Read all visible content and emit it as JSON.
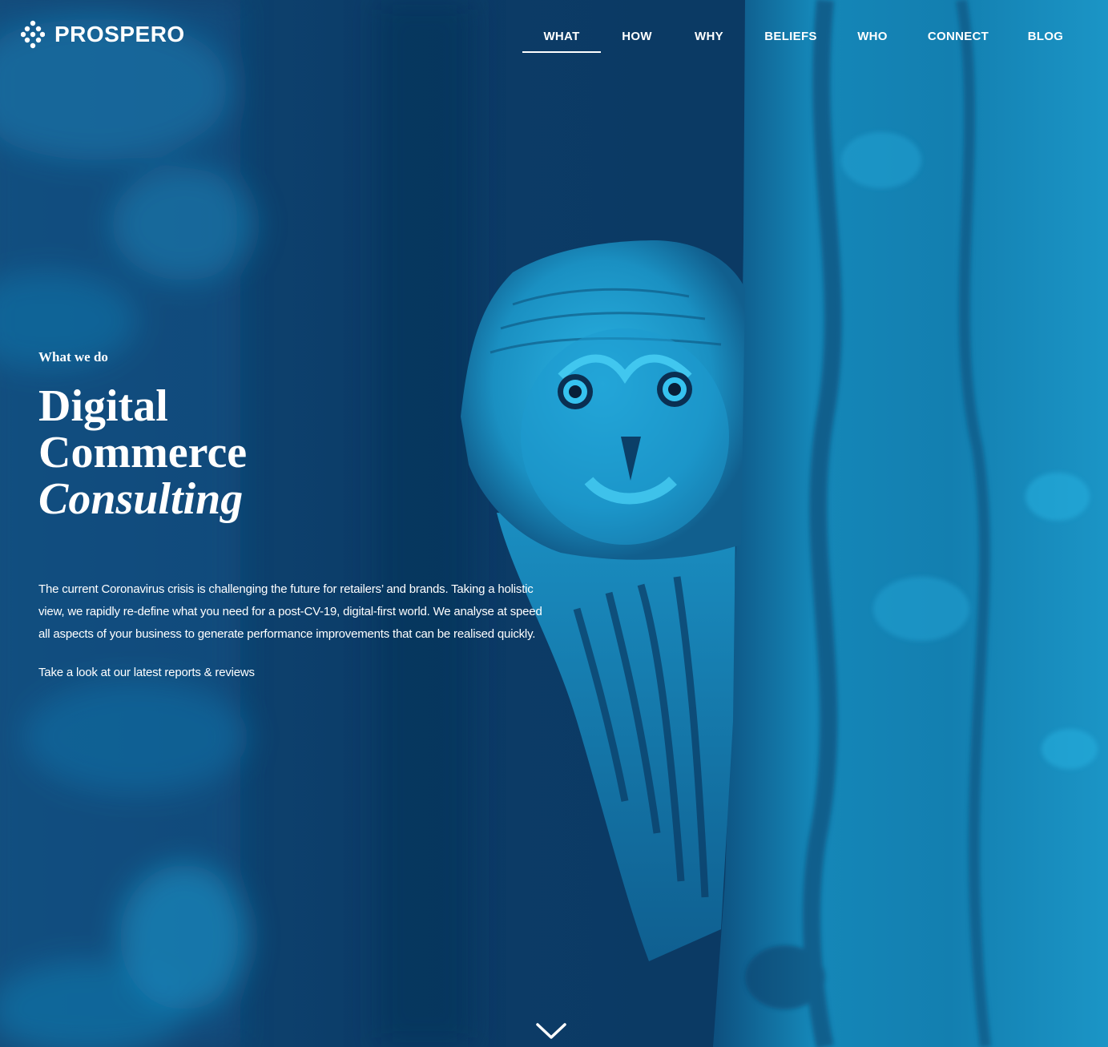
{
  "brand": {
    "name": "PROSPERO",
    "logo_icon": "dots-cluster-icon",
    "accent_color": "#1ea8d6",
    "background_color": "#0c3a63"
  },
  "nav": {
    "items": [
      {
        "label": "WHAT",
        "active": true
      },
      {
        "label": "HOW",
        "active": false
      },
      {
        "label": "WHY",
        "active": false
      },
      {
        "label": "BELIEFS",
        "active": false
      },
      {
        "label": "WHO",
        "active": false
      },
      {
        "label": "CONNECT",
        "active": false
      },
      {
        "label": "BLOG",
        "active": false
      }
    ]
  },
  "hero": {
    "eyebrow": "What we do",
    "headline_line1": "Digital",
    "headline_line2": "Commerce",
    "headline_line3": "Consulting",
    "body": "The current Coronavirus crisis is challenging the future for retailers’ and brands. Taking a holistic view, we rapidly re-define what you need for a post-CV-19, digital-first world. We analyse at speed all aspects of your business to generate performance improvements that can be realised quickly.",
    "cta": "Take a look at our latest reports & reviews",
    "image_subject": "owl-peeking-from-tree",
    "scroll_icon": "chevron-down-icon"
  }
}
